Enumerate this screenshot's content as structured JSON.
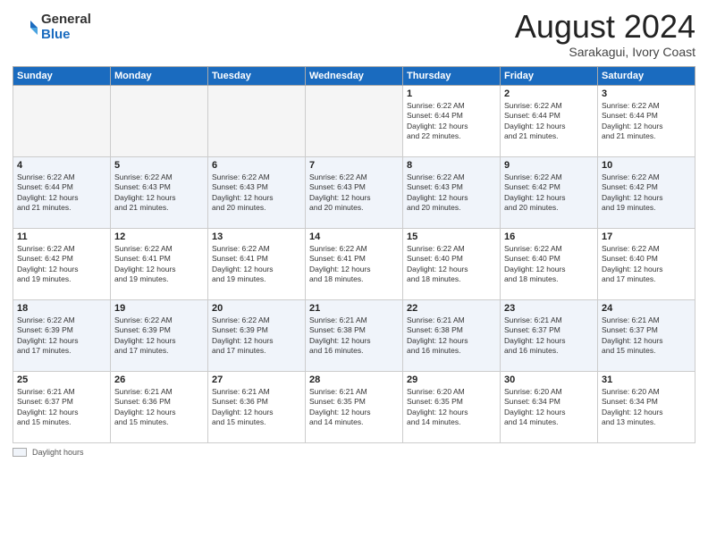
{
  "logo": {
    "general": "General",
    "blue": "Blue"
  },
  "header": {
    "month_year": "August 2024",
    "location": "Sarakagui, Ivory Coast"
  },
  "days_of_week": [
    "Sunday",
    "Monday",
    "Tuesday",
    "Wednesday",
    "Thursday",
    "Friday",
    "Saturday"
  ],
  "weeks": [
    [
      {
        "day": "",
        "info": ""
      },
      {
        "day": "",
        "info": ""
      },
      {
        "day": "",
        "info": ""
      },
      {
        "day": "",
        "info": ""
      },
      {
        "day": "1",
        "info": "Sunrise: 6:22 AM\nSunset: 6:44 PM\nDaylight: 12 hours\nand 22 minutes."
      },
      {
        "day": "2",
        "info": "Sunrise: 6:22 AM\nSunset: 6:44 PM\nDaylight: 12 hours\nand 21 minutes."
      },
      {
        "day": "3",
        "info": "Sunrise: 6:22 AM\nSunset: 6:44 PM\nDaylight: 12 hours\nand 21 minutes."
      }
    ],
    [
      {
        "day": "4",
        "info": "Sunrise: 6:22 AM\nSunset: 6:44 PM\nDaylight: 12 hours\nand 21 minutes."
      },
      {
        "day": "5",
        "info": "Sunrise: 6:22 AM\nSunset: 6:43 PM\nDaylight: 12 hours\nand 21 minutes."
      },
      {
        "day": "6",
        "info": "Sunrise: 6:22 AM\nSunset: 6:43 PM\nDaylight: 12 hours\nand 20 minutes."
      },
      {
        "day": "7",
        "info": "Sunrise: 6:22 AM\nSunset: 6:43 PM\nDaylight: 12 hours\nand 20 minutes."
      },
      {
        "day": "8",
        "info": "Sunrise: 6:22 AM\nSunset: 6:43 PM\nDaylight: 12 hours\nand 20 minutes."
      },
      {
        "day": "9",
        "info": "Sunrise: 6:22 AM\nSunset: 6:42 PM\nDaylight: 12 hours\nand 20 minutes."
      },
      {
        "day": "10",
        "info": "Sunrise: 6:22 AM\nSunset: 6:42 PM\nDaylight: 12 hours\nand 19 minutes."
      }
    ],
    [
      {
        "day": "11",
        "info": "Sunrise: 6:22 AM\nSunset: 6:42 PM\nDaylight: 12 hours\nand 19 minutes."
      },
      {
        "day": "12",
        "info": "Sunrise: 6:22 AM\nSunset: 6:41 PM\nDaylight: 12 hours\nand 19 minutes."
      },
      {
        "day": "13",
        "info": "Sunrise: 6:22 AM\nSunset: 6:41 PM\nDaylight: 12 hours\nand 19 minutes."
      },
      {
        "day": "14",
        "info": "Sunrise: 6:22 AM\nSunset: 6:41 PM\nDaylight: 12 hours\nand 18 minutes."
      },
      {
        "day": "15",
        "info": "Sunrise: 6:22 AM\nSunset: 6:40 PM\nDaylight: 12 hours\nand 18 minutes."
      },
      {
        "day": "16",
        "info": "Sunrise: 6:22 AM\nSunset: 6:40 PM\nDaylight: 12 hours\nand 18 minutes."
      },
      {
        "day": "17",
        "info": "Sunrise: 6:22 AM\nSunset: 6:40 PM\nDaylight: 12 hours\nand 17 minutes."
      }
    ],
    [
      {
        "day": "18",
        "info": "Sunrise: 6:22 AM\nSunset: 6:39 PM\nDaylight: 12 hours\nand 17 minutes."
      },
      {
        "day": "19",
        "info": "Sunrise: 6:22 AM\nSunset: 6:39 PM\nDaylight: 12 hours\nand 17 minutes."
      },
      {
        "day": "20",
        "info": "Sunrise: 6:22 AM\nSunset: 6:39 PM\nDaylight: 12 hours\nand 17 minutes."
      },
      {
        "day": "21",
        "info": "Sunrise: 6:21 AM\nSunset: 6:38 PM\nDaylight: 12 hours\nand 16 minutes."
      },
      {
        "day": "22",
        "info": "Sunrise: 6:21 AM\nSunset: 6:38 PM\nDaylight: 12 hours\nand 16 minutes."
      },
      {
        "day": "23",
        "info": "Sunrise: 6:21 AM\nSunset: 6:37 PM\nDaylight: 12 hours\nand 16 minutes."
      },
      {
        "day": "24",
        "info": "Sunrise: 6:21 AM\nSunset: 6:37 PM\nDaylight: 12 hours\nand 15 minutes."
      }
    ],
    [
      {
        "day": "25",
        "info": "Sunrise: 6:21 AM\nSunset: 6:37 PM\nDaylight: 12 hours\nand 15 minutes."
      },
      {
        "day": "26",
        "info": "Sunrise: 6:21 AM\nSunset: 6:36 PM\nDaylight: 12 hours\nand 15 minutes."
      },
      {
        "day": "27",
        "info": "Sunrise: 6:21 AM\nSunset: 6:36 PM\nDaylight: 12 hours\nand 15 minutes."
      },
      {
        "day": "28",
        "info": "Sunrise: 6:21 AM\nSunset: 6:35 PM\nDaylight: 12 hours\nand 14 minutes."
      },
      {
        "day": "29",
        "info": "Sunrise: 6:20 AM\nSunset: 6:35 PM\nDaylight: 12 hours\nand 14 minutes."
      },
      {
        "day": "30",
        "info": "Sunrise: 6:20 AM\nSunset: 6:34 PM\nDaylight: 12 hours\nand 14 minutes."
      },
      {
        "day": "31",
        "info": "Sunrise: 6:20 AM\nSunset: 6:34 PM\nDaylight: 12 hours\nand 13 minutes."
      }
    ]
  ],
  "footer": {
    "daylight_label": "Daylight hours"
  }
}
